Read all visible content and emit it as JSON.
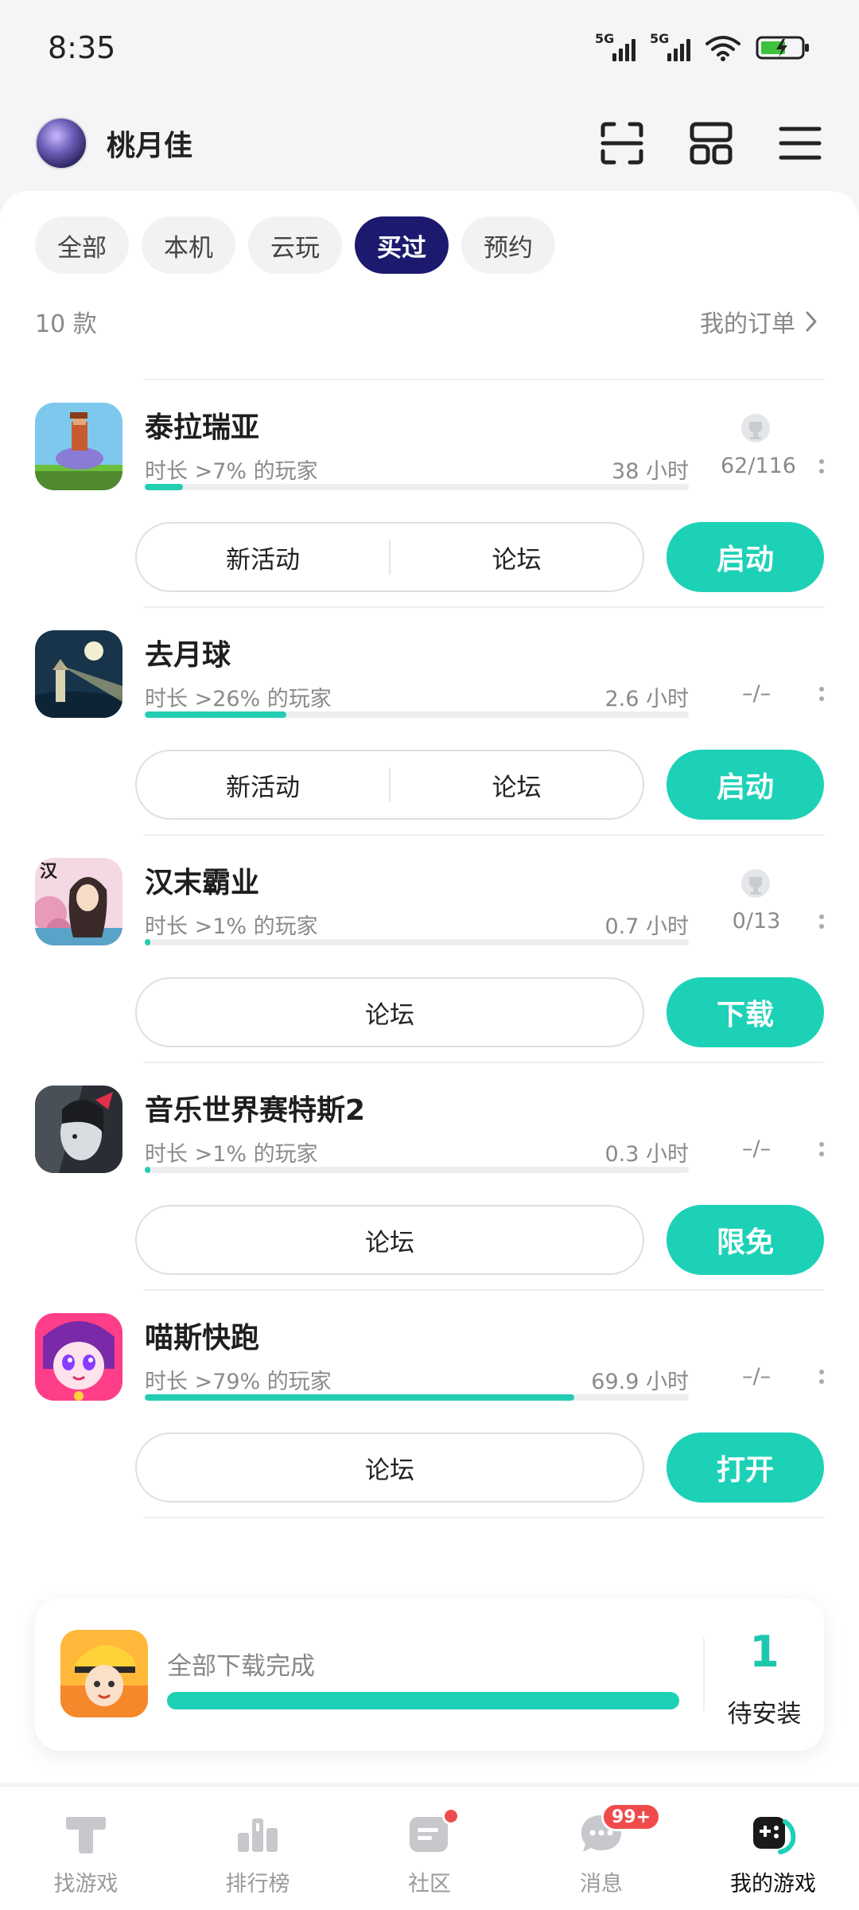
{
  "status_bar": {
    "time": "8:35",
    "sim1": "5G",
    "sim2": "5G"
  },
  "header": {
    "username": "桃月佳"
  },
  "filters": [
    {
      "label": "全部",
      "active": false
    },
    {
      "label": "本机",
      "active": false
    },
    {
      "label": "云玩",
      "active": false
    },
    {
      "label": "买过",
      "active": true
    },
    {
      "label": "预约",
      "active": false
    }
  ],
  "summary": {
    "count": "10 款",
    "orders_link": "我的订单"
  },
  "games": [
    {
      "name": "泰拉瑞亚",
      "stat": "时长 >7% 的玩家",
      "hours": "38 小时",
      "progress": 0.07,
      "achievements": "62/116",
      "actions": [
        "新活动",
        "论坛"
      ],
      "primary": "启动"
    },
    {
      "name": "去月球",
      "stat": "时长 >26% 的玩家",
      "hours": "2.6 小时",
      "progress": 0.26,
      "achievements": "–/–",
      "actions": [
        "新活动",
        "论坛"
      ],
      "primary": "启动"
    },
    {
      "name": "汉末霸业",
      "stat": "时长 >1% 的玩家",
      "hours": "0.7 小时",
      "progress": 0.01,
      "achievements": "0/13",
      "actions": [
        "论坛"
      ],
      "primary": "下载"
    },
    {
      "name": "音乐世界赛特斯2",
      "stat": "时长 >1% 的玩家",
      "hours": "0.3 小时",
      "progress": 0.01,
      "achievements": "–/–",
      "actions": [
        "论坛"
      ],
      "primary": "限免"
    },
    {
      "name": "喵斯快跑",
      "stat": "时长 >79% 的玩家",
      "hours": "69.9 小时",
      "progress": 0.79,
      "achievements": "–/–",
      "actions": [
        "论坛"
      ],
      "primary": "打开"
    }
  ],
  "download_card": {
    "text": "全部下载完成",
    "progress": 1.0,
    "pending_count": "1",
    "pending_label": "待安装"
  },
  "tabs": [
    {
      "label": "找游戏"
    },
    {
      "label": "排行榜"
    },
    {
      "label": "社区"
    },
    {
      "label": "消息",
      "badge": "99+"
    },
    {
      "label": "我的游戏"
    }
  ],
  "colors": {
    "accent": "#1dd1b7",
    "active_chip": "#1c1a6e",
    "badge": "#f04b4b"
  }
}
